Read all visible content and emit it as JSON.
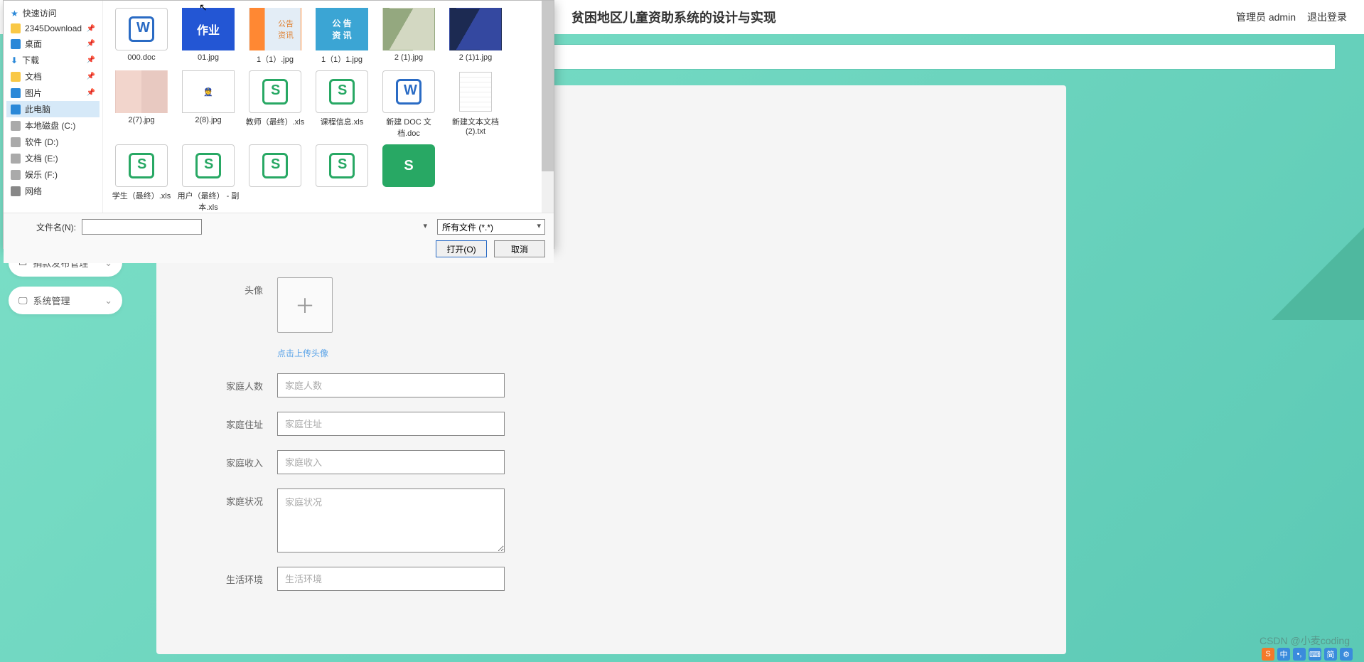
{
  "header": {
    "title": "贫困地区儿童资助系统的设计与实现",
    "user_label": "管理员 admin",
    "logout": "退出登录"
  },
  "sidebar": {
    "items": [
      {
        "label": "捐款发布管理",
        "icon": "card-icon"
      },
      {
        "label": "系统管理",
        "icon": "monitor-icon"
      }
    ]
  },
  "form": {
    "avatar_label": "头像",
    "avatar_hint": "点击上传头像",
    "fields": [
      {
        "label": "家庭人数",
        "placeholder": "家庭人数",
        "type": "text"
      },
      {
        "label": "家庭住址",
        "placeholder": "家庭住址",
        "type": "text"
      },
      {
        "label": "家庭收入",
        "placeholder": "家庭收入",
        "type": "text"
      },
      {
        "label": "家庭状况",
        "placeholder": "家庭状况",
        "type": "textarea"
      },
      {
        "label": "生活环境",
        "placeholder": "生活环境",
        "type": "text"
      }
    ]
  },
  "dialog": {
    "tree": [
      {
        "label": "快速访问",
        "icon": "star",
        "pinned": false
      },
      {
        "label": "2345Download",
        "icon": "folder",
        "pinned": true
      },
      {
        "label": "桌面",
        "icon": "blue",
        "pinned": true
      },
      {
        "label": "下载",
        "icon": "down",
        "pinned": true
      },
      {
        "label": "文档",
        "icon": "folder",
        "pinned": true
      },
      {
        "label": "图片",
        "icon": "blue",
        "pinned": true
      },
      {
        "label": "此电脑",
        "icon": "monitor",
        "selected": true
      },
      {
        "label": "本地磁盘 (C:)",
        "icon": "drive"
      },
      {
        "label": "软件 (D:)",
        "icon": "drive"
      },
      {
        "label": "文档 (E:)",
        "icon": "drive"
      },
      {
        "label": "娱乐 (F:)",
        "icon": "drive"
      },
      {
        "label": "网络",
        "icon": "net"
      }
    ],
    "files": [
      {
        "name": "000.doc",
        "kind": "word"
      },
      {
        "name": "01.jpg",
        "kind": "img-blue",
        "text": "作业"
      },
      {
        "name": "1（1）.jpg",
        "kind": "img-orange"
      },
      {
        "name": "1（1）1.jpg",
        "kind": "img-green",
        "line1": "公 告",
        "line2": "资 讯"
      },
      {
        "name": "2 (1).jpg",
        "kind": "img-photo1"
      },
      {
        "name": "2 (1)1.jpg",
        "kind": "img-photo2"
      },
      {
        "name": "2(7).jpg",
        "kind": "img-babies"
      },
      {
        "name": "2(8).jpg",
        "kind": "img-cartoon"
      },
      {
        "name": "教师（最终）.xls",
        "kind": "xls"
      },
      {
        "name": "课程信息.xls",
        "kind": "xls"
      },
      {
        "name": "新建 DOC 文档.doc",
        "kind": "word"
      },
      {
        "name": "新建文本文档(2).txt",
        "kind": "txt"
      },
      {
        "name": "学生（最终）.xls",
        "kind": "xls"
      },
      {
        "name": "用户（最终） - 副本.xls",
        "kind": "xls"
      },
      {
        "name": "",
        "kind": "xls"
      },
      {
        "name": "",
        "kind": "xls"
      },
      {
        "name": "",
        "kind": "xls-solid"
      }
    ],
    "filename_label": "文件名(N):",
    "filename_value": "",
    "filter_value": "所有文件 (*.*)",
    "open_btn": "打开(O)",
    "cancel_btn": "取消"
  },
  "watermark": "CSDN @小麦coding",
  "ime": {
    "items": [
      "S",
      "中",
      "•,",
      "⌨",
      "简",
      "⚙"
    ]
  },
  "colors": {
    "accent": "#5cc9b5",
    "primary_blue": "#2a6bc4",
    "green": "#28a864"
  }
}
